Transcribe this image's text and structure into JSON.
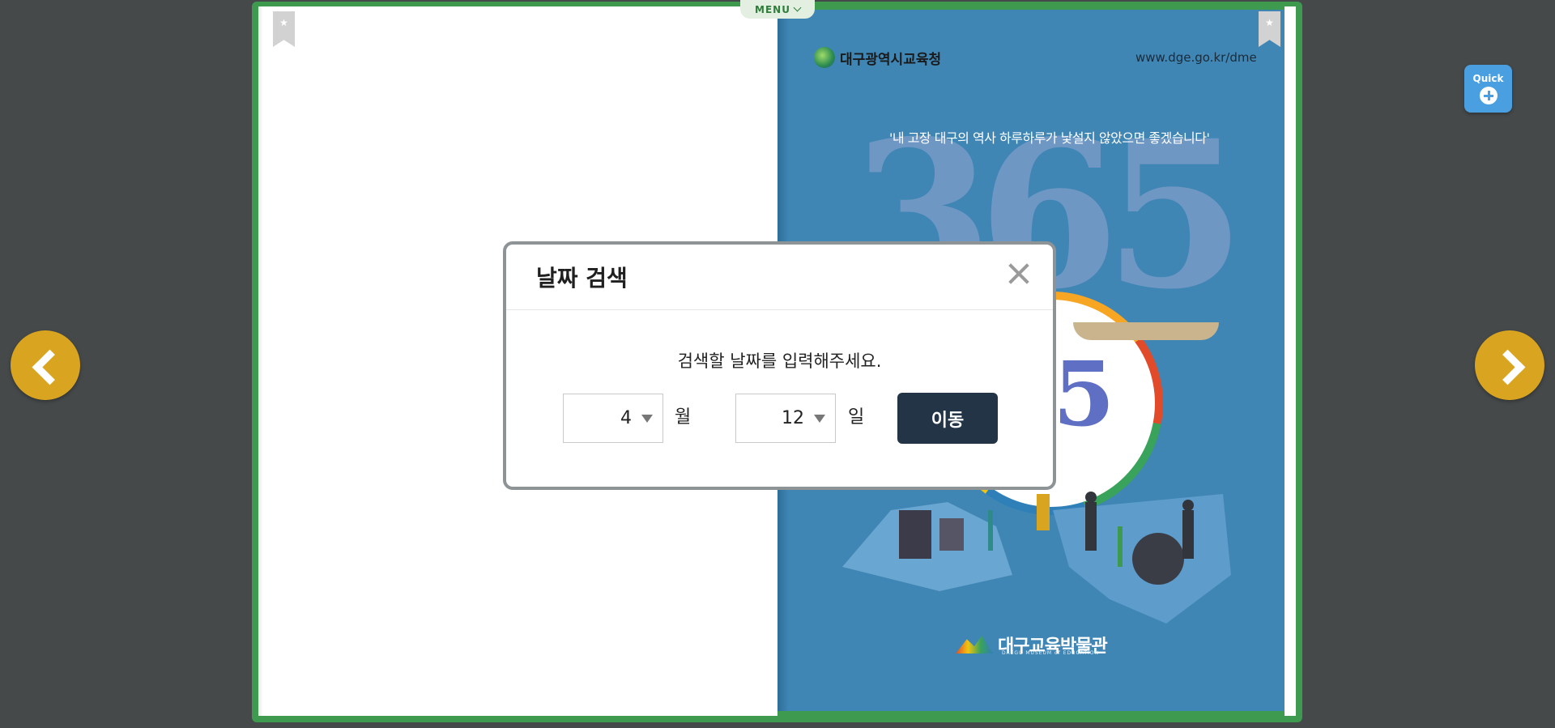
{
  "book": {
    "menu_label": "MENU",
    "cover": {
      "org_name": "대구광역시교육청",
      "url": "www.dge.go.kr/dme",
      "tagline": "'내 고장 대구의 역사 하루하루가 낯설지 않았으면 좋겠습니다'",
      "big_number": "365",
      "number_fragment": "5",
      "museum_name": "대구교육박물관",
      "museum_english": "DAEGU MUSEUM of EDUCATION"
    }
  },
  "quick": {
    "label": "Quick"
  },
  "dialog": {
    "title": "날짜 검색",
    "message": "검색할 날짜를 입력해주세요.",
    "month_value": "4",
    "month_unit": "월",
    "day_value": "12",
    "day_unit": "일",
    "go_label": "이동"
  },
  "colors": {
    "background": "#45494a",
    "book_border": "#3e9a4f",
    "cover_blue": "#3f86b5",
    "nav_button": "#d9a420",
    "quick_button": "#4a9fe0",
    "go_button": "#243447"
  }
}
